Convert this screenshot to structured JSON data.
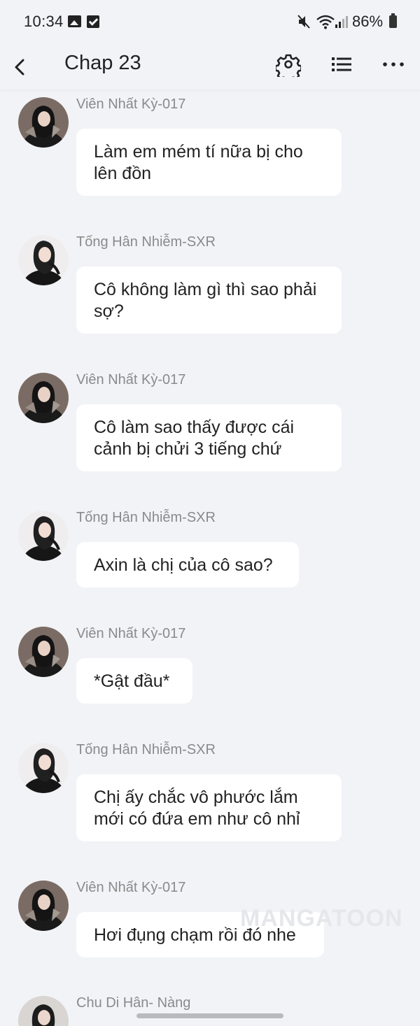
{
  "status_bar": {
    "time": "10:34",
    "battery": "86%",
    "icons": [
      "gallery-icon",
      "checkbox-icon",
      "mute-icon",
      "wifi-icon",
      "signal-icon",
      "battery-icon"
    ]
  },
  "header": {
    "title": "Chap 23",
    "icons": [
      "back-arrow-icon",
      "settings-gear-icon",
      "list-icon",
      "more-horizontal-icon"
    ]
  },
  "messages": [
    {
      "author": "Viên Nhất Kỳ-017",
      "text": "Làm em mém tí nữa bị cho lên đồn"
    },
    {
      "author": "Tống Hân Nhiễm-SXR",
      "text": "Cô không làm gì thì sao phải sợ?"
    },
    {
      "author": "Viên Nhất Kỳ-017",
      "text": "Cô làm sao thấy được cái cảnh bị chửi 3 tiếng chứ"
    },
    {
      "author": "Tống Hân Nhiễm-SXR",
      "text": "Axin là chị của cô sao?"
    },
    {
      "author": "Viên Nhất Kỳ-017",
      "text": "*Gật đầu*"
    },
    {
      "author": "Tống Hân Nhiễm-SXR",
      "text": "Chị ấy chắc vô phước lắm mới có đứa em như cô nhỉ"
    },
    {
      "author": "Viên Nhất Kỳ-017",
      "text": "Hơi đụng chạm rồi đó nhe"
    },
    {
      "author": "Chu Di Hân- Nàng",
      "text": ""
    }
  ],
  "watermark": "MANGATOON",
  "colors": {
    "background": "#f2f3f7",
    "bubble": "#ffffff",
    "author_name": "#8a8a8a",
    "text": "#222222"
  }
}
